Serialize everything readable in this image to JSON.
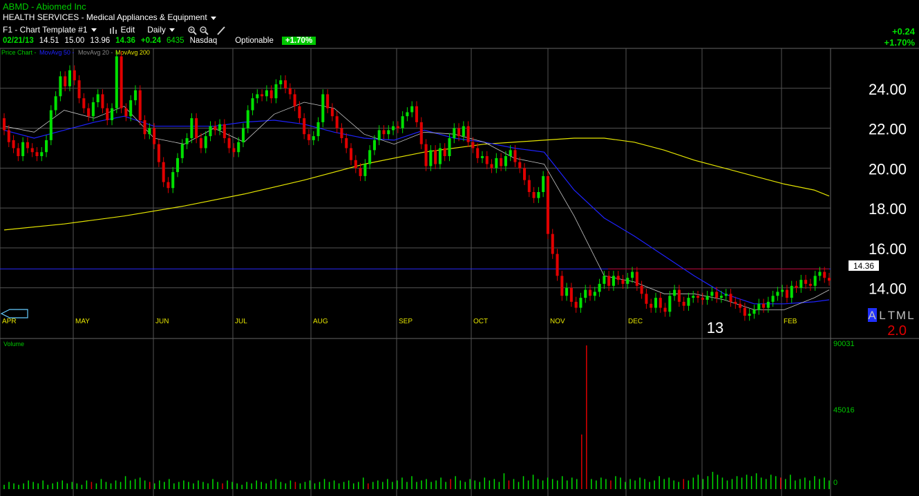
{
  "header": {
    "title": "ABMD - Abiomed Inc",
    "sector": "HEALTH SERVICES - Medical Appliances & Equipment",
    "toolbar": {
      "template": "F1 - Chart Template #1",
      "edit": "Edit",
      "period": "Daily"
    },
    "quote": {
      "date": "02/21/13",
      "open": "14.51",
      "high": "15.00",
      "low": "13.96",
      "close": "14.36",
      "change": "+0.24",
      "volume": "6435",
      "exchange": "Nasdaq",
      "optionable": "Optionable",
      "pct": "+1.70%"
    },
    "change_abs": "+0.24",
    "change_pct": "+1.70%"
  },
  "legend": {
    "price": "Price Chart -",
    "ma50": "MovAvg 50 -",
    "ma20": "MovAvg 20 -",
    "ma200": "MovAvg 200"
  },
  "volume_label": "Volume",
  "price_tag": "14.36",
  "year_label": "13",
  "rating": {
    "letters": [
      "A",
      "L",
      "T",
      "M",
      "L"
    ],
    "value": "2.0"
  },
  "colors": {
    "up": "#00e000",
    "down": "#e00000",
    "ma50": "#1e22ff",
    "ma20": "#c8c8c8",
    "ma200": "#e6e600",
    "grid": "#555555",
    "hline": "#2a2aff",
    "resist": "#c00000"
  },
  "chart_data": {
    "type": "candlestick",
    "y_ticks": [
      "24.00",
      "22.00",
      "20.00",
      "18.00",
      "16.00",
      "14.00"
    ],
    "ylim": [
      12.5,
      26.0
    ],
    "months": [
      "APR",
      "MAY",
      "JUN",
      "JUL",
      "AUG",
      "SEP",
      "OCT",
      "NOV",
      "DEC",
      "FEB"
    ],
    "volume_ticks": [
      "90031",
      "45016",
      "0"
    ],
    "volume_ylim": [
      0,
      90031
    ],
    "horizontal_line": 14.95,
    "last_price": 14.36,
    "ma200": [
      [
        0,
        16.9
      ],
      [
        20,
        17.2
      ],
      [
        40,
        17.6
      ],
      [
        60,
        18.1
      ],
      [
        80,
        18.7
      ],
      [
        100,
        19.4
      ],
      [
        120,
        20.2
      ],
      [
        140,
        20.8
      ],
      [
        160,
        21.2
      ],
      [
        180,
        21.4
      ],
      [
        190,
        21.5
      ],
      [
        200,
        21.5
      ],
      [
        210,
        21.3
      ],
      [
        220,
        20.9
      ],
      [
        230,
        20.4
      ],
      [
        240,
        20.0
      ],
      [
        250,
        19.6
      ],
      [
        260,
        19.2
      ],
      [
        270,
        18.9
      ],
      [
        275,
        18.6
      ]
    ],
    "ma50": [
      [
        0,
        21.9
      ],
      [
        10,
        21.5
      ],
      [
        20,
        21.9
      ],
      [
        30,
        22.3
      ],
      [
        40,
        22.6
      ],
      [
        50,
        22.1
      ],
      [
        60,
        22.1
      ],
      [
        70,
        22.1
      ],
      [
        80,
        22.3
      ],
      [
        90,
        22.4
      ],
      [
        100,
        22.2
      ],
      [
        110,
        21.8
      ],
      [
        120,
        21.5
      ],
      [
        130,
        21.4
      ],
      [
        140,
        21.9
      ],
      [
        150,
        21.5
      ],
      [
        160,
        21.3
      ],
      [
        170,
        21.0
      ],
      [
        180,
        20.8
      ],
      [
        190,
        18.9
      ],
      [
        200,
        17.5
      ],
      [
        210,
        16.6
      ],
      [
        220,
        15.6
      ],
      [
        230,
        14.6
      ],
      [
        240,
        13.7
      ],
      [
        250,
        13.2
      ],
      [
        260,
        13.2
      ],
      [
        270,
        13.3
      ],
      [
        275,
        13.4
      ]
    ],
    "ma20": [
      [
        0,
        22.1
      ],
      [
        10,
        21.8
      ],
      [
        20,
        22.9
      ],
      [
        30,
        22.5
      ],
      [
        40,
        23.1
      ],
      [
        50,
        21.5
      ],
      [
        60,
        21.2
      ],
      [
        70,
        22.0
      ],
      [
        80,
        21.3
      ],
      [
        90,
        22.7
      ],
      [
        100,
        23.3
      ],
      [
        110,
        23.0
      ],
      [
        120,
        21.7
      ],
      [
        130,
        21.2
      ],
      [
        140,
        21.8
      ],
      [
        150,
        21.7
      ],
      [
        160,
        21.3
      ],
      [
        170,
        20.5
      ],
      [
        180,
        20.2
      ],
      [
        190,
        17.6
      ],
      [
        200,
        14.6
      ],
      [
        210,
        14.3
      ],
      [
        220,
        13.7
      ],
      [
        230,
        13.7
      ],
      [
        240,
        13.4
      ],
      [
        250,
        12.9
      ],
      [
        260,
        12.9
      ],
      [
        270,
        13.5
      ],
      [
        275,
        13.9
      ]
    ],
    "candles": [
      [
        22.5,
        21.9
      ],
      [
        21.9,
        21.3
      ],
      [
        21.4,
        21.0
      ],
      [
        21.0,
        20.6
      ],
      [
        20.6,
        21.3
      ],
      [
        21.3,
        21.0
      ],
      [
        21.0,
        20.8
      ],
      [
        20.8,
        20.6
      ],
      [
        20.6,
        20.8
      ],
      [
        20.8,
        21.4
      ],
      [
        21.4,
        22.9
      ],
      [
        22.9,
        23.6
      ],
      [
        23.6,
        24.6
      ],
      [
        24.6,
        24.1
      ],
      [
        24.1,
        24.9
      ],
      [
        24.9,
        24.4
      ],
      [
        24.4,
        23.5
      ],
      [
        23.5,
        23.0
      ],
      [
        23.0,
        22.6
      ],
      [
        22.6,
        23.3
      ],
      [
        23.3,
        23.7
      ],
      [
        23.7,
        23.0
      ],
      [
        23.0,
        22.4
      ],
      [
        22.4,
        23.0
      ],
      [
        23.0,
        25.6
      ],
      [
        25.6,
        23.0
      ],
      [
        23.0,
        22.6
      ],
      [
        22.6,
        23.4
      ],
      [
        23.4,
        23.9
      ],
      [
        23.9,
        22.4
      ],
      [
        22.4,
        21.7
      ],
      [
        21.7,
        22.0
      ],
      [
        22.0,
        21.2
      ],
      [
        21.2,
        20.3
      ],
      [
        20.3,
        19.3
      ],
      [
        19.3,
        19.0
      ],
      [
        19.0,
        19.8
      ],
      [
        19.8,
        20.5
      ],
      [
        20.5,
        21.2
      ],
      [
        21.2,
        21.5
      ],
      [
        21.5,
        22.5
      ],
      [
        22.5,
        21.5
      ],
      [
        21.5,
        21.0
      ],
      [
        21.0,
        21.6
      ],
      [
        21.6,
        22.1
      ],
      [
        22.1,
        21.9
      ],
      [
        21.9,
        22.2
      ],
      [
        22.2,
        21.5
      ],
      [
        21.5,
        21.0
      ],
      [
        21.0,
        20.8
      ],
      [
        20.8,
        21.3
      ],
      [
        21.3,
        22.0
      ],
      [
        22.0,
        22.9
      ],
      [
        22.9,
        23.5
      ],
      [
        23.5,
        23.7
      ],
      [
        23.7,
        23.6
      ],
      [
        23.6,
        23.9
      ],
      [
        23.9,
        23.5
      ],
      [
        23.5,
        24.2
      ],
      [
        24.2,
        24.4
      ],
      [
        24.4,
        24.0
      ],
      [
        24.0,
        23.7
      ],
      [
        23.7,
        23.1
      ],
      [
        23.1,
        22.5
      ],
      [
        22.5,
        21.7
      ],
      [
        21.7,
        21.4
      ],
      [
        21.4,
        21.6
      ],
      [
        21.6,
        22.3
      ],
      [
        22.3,
        23.7
      ],
      [
        23.7,
        23.0
      ],
      [
        23.0,
        22.6
      ],
      [
        22.6,
        22.0
      ],
      [
        22.0,
        21.5
      ],
      [
        21.5,
        21.0
      ],
      [
        21.0,
        20.4
      ],
      [
        20.4,
        20.0
      ],
      [
        20.0,
        19.6
      ],
      [
        19.6,
        20.2
      ],
      [
        20.2,
        20.9
      ],
      [
        20.9,
        21.4
      ],
      [
        21.4,
        21.9
      ],
      [
        21.9,
        21.7
      ],
      [
        21.7,
        21.9
      ],
      [
        21.9,
        22.1
      ],
      [
        22.1,
        22.0
      ],
      [
        22.0,
        22.6
      ],
      [
        22.6,
        22.8
      ],
      [
        22.8,
        23.1
      ],
      [
        23.1,
        22.3
      ],
      [
        22.3,
        21.2
      ],
      [
        21.2,
        20.1
      ],
      [
        20.1,
        20.9
      ],
      [
        20.9,
        20.2
      ],
      [
        20.2,
        21.0
      ],
      [
        21.0,
        20.6
      ],
      [
        20.6,
        21.5
      ],
      [
        21.5,
        22.0
      ],
      [
        22.0,
        21.6
      ],
      [
        21.6,
        22.1
      ],
      [
        22.1,
        21.3
      ],
      [
        21.3,
        21.0
      ],
      [
        21.0,
        20.5
      ],
      [
        20.5,
        20.6
      ],
      [
        20.6,
        20.2
      ],
      [
        20.2,
        20.0
      ],
      [
        20.0,
        20.5
      ],
      [
        20.5,
        20.1
      ],
      [
        20.1,
        20.6
      ],
      [
        20.6,
        20.9
      ],
      [
        20.9,
        20.3
      ],
      [
        20.3,
        20.0
      ],
      [
        20.0,
        19.4
      ],
      [
        19.4,
        18.8
      ],
      [
        18.8,
        18.5
      ],
      [
        18.5,
        18.8
      ],
      [
        18.8,
        19.6
      ],
      [
        19.6,
        16.7
      ],
      [
        16.7,
        15.7
      ],
      [
        15.7,
        14.6
      ],
      [
        14.6,
        13.6
      ],
      [
        13.6,
        14.0
      ],
      [
        14.0,
        13.3
      ],
      [
        13.3,
        13.0
      ],
      [
        13.0,
        13.5
      ],
      [
        13.5,
        13.9
      ],
      [
        13.9,
        13.6
      ],
      [
        13.6,
        13.8
      ],
      [
        13.8,
        14.2
      ],
      [
        14.2,
        14.6
      ],
      [
        14.6,
        14.1
      ],
      [
        14.1,
        14.6
      ],
      [
        14.6,
        14.4
      ],
      [
        14.4,
        14.2
      ],
      [
        14.2,
        14.5
      ],
      [
        14.5,
        14.8
      ],
      [
        14.8,
        14.1
      ],
      [
        14.1,
        13.7
      ],
      [
        13.7,
        13.2
      ],
      [
        13.2,
        13.0
      ],
      [
        13.0,
        13.5
      ],
      [
        13.5,
        13.0
      ],
      [
        13.0,
        12.8
      ],
      [
        12.8,
        13.6
      ],
      [
        13.6,
        13.9
      ],
      [
        13.9,
        13.3
      ],
      [
        13.3,
        13.1
      ],
      [
        13.1,
        13.5
      ],
      [
        13.5,
        13.6
      ],
      [
        13.6,
        13.5
      ],
      [
        13.5,
        13.4
      ],
      [
        13.4,
        13.6
      ],
      [
        13.6,
        13.8
      ],
      [
        13.8,
        13.5
      ],
      [
        13.5,
        13.6
      ],
      [
        13.6,
        13.7
      ],
      [
        13.7,
        13.3
      ],
      [
        13.3,
        13.2
      ],
      [
        13.2,
        13.0
      ],
      [
        13.0,
        12.6
      ],
      [
        12.6,
        12.7
      ],
      [
        12.7,
        12.9
      ],
      [
        12.9,
        13.2
      ],
      [
        13.2,
        13.0
      ],
      [
        13.0,
        13.3
      ],
      [
        13.3,
        13.6
      ],
      [
        13.6,
        13.8
      ],
      [
        13.8,
        13.9
      ],
      [
        13.9,
        13.5
      ],
      [
        13.5,
        14.1
      ],
      [
        14.1,
        14.0
      ],
      [
        14.0,
        14.4
      ],
      [
        14.4,
        14.2
      ],
      [
        14.2,
        14.1
      ],
      [
        14.1,
        14.6
      ],
      [
        14.6,
        14.8
      ],
      [
        14.8,
        14.5
      ],
      [
        14.5,
        14.36
      ]
    ],
    "volume_up": [
      3,
      5,
      4,
      3,
      4,
      6,
      5,
      4,
      6,
      3,
      4,
      5,
      6,
      4,
      5,
      4,
      3,
      6,
      5,
      4,
      7,
      5,
      4,
      6,
      5,
      9,
      6,
      7,
      8,
      6,
      5,
      4,
      6,
      5,
      7,
      4,
      5,
      6,
      5,
      4,
      6,
      5,
      4,
      7,
      5,
      4,
      6,
      5,
      4,
      3,
      5,
      4,
      6,
      5,
      4,
      6,
      7,
      5,
      4,
      6,
      5,
      4,
      5,
      6,
      4,
      5,
      7,
      5,
      6,
      4,
      5,
      6,
      4,
      5,
      8,
      4,
      5,
      6,
      5,
      7,
      5,
      6,
      8,
      5,
      9,
      5,
      6,
      7,
      5,
      6,
      8,
      5,
      7,
      9,
      6,
      5,
      7,
      6,
      5,
      8,
      6,
      7,
      5,
      11,
      6,
      7,
      5,
      9,
      6,
      10,
      7,
      6,
      8,
      7,
      6,
      9,
      6,
      8,
      7,
      36,
      9,
      7,
      6,
      8,
      7,
      6,
      9,
      8,
      5,
      7,
      6,
      8,
      7,
      5,
      6,
      9,
      7,
      8,
      6,
      5,
      7,
      6,
      8,
      10,
      7,
      9,
      12,
      10,
      8,
      6,
      7,
      9,
      8,
      10,
      9,
      11,
      8,
      7,
      10,
      9,
      8,
      7,
      10,
      6,
      7,
      8,
      6,
      9,
      7,
      8,
      6
    ],
    "volume_down_idx": [
      18,
      30,
      45,
      60,
      75,
      92,
      104,
      120,
      125,
      140,
      160,
      178,
      188,
      190,
      191,
      197,
      215,
      225,
      240,
      255
    ]
  }
}
